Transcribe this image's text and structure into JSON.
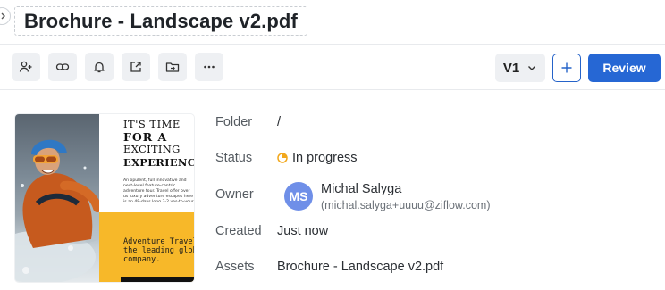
{
  "header": {
    "title": "Brochure - Landscape v2.pdf"
  },
  "toolbar": {
    "tools": [
      {
        "icon": "add-user-icon"
      },
      {
        "icon": "link-icon"
      },
      {
        "icon": "bell-icon"
      },
      {
        "icon": "share-icon"
      },
      {
        "icon": "folder-move-icon"
      },
      {
        "icon": "more-icon"
      }
    ],
    "version": "V1",
    "add_icon": "plus-icon",
    "review_label": "Review"
  },
  "thumbnail": {
    "heading": [
      "IT'S TIME",
      "FOR A",
      "EXCITING",
      "EXPERIENCE"
    ],
    "body": "An opulent, full innovative and next-level feature-centric adventure tour. Travel offer over us luxury adventure escapes here is an 48-days long 3-2 yes-to-your whole world.",
    "tagline": [
      "Adventure Travel is",
      "the leading global tra",
      "company."
    ]
  },
  "details": {
    "folder": {
      "label": "Folder",
      "value": "/"
    },
    "status": {
      "label": "Status",
      "value": "In progress",
      "color": "#f2a81d"
    },
    "owner": {
      "label": "Owner",
      "initials": "MS",
      "name": "Michal Salyga",
      "email": "(michal.salyga+uuuu@ziflow.com)",
      "avatar_color": "#6f8fe8"
    },
    "created": {
      "label": "Created",
      "value": "Just now"
    },
    "assets": {
      "label": "Assets",
      "value": "Brochure - Landscape v2.pdf"
    }
  },
  "colors": {
    "accent": "#2667d4",
    "tool_bg": "#eef0f3"
  }
}
